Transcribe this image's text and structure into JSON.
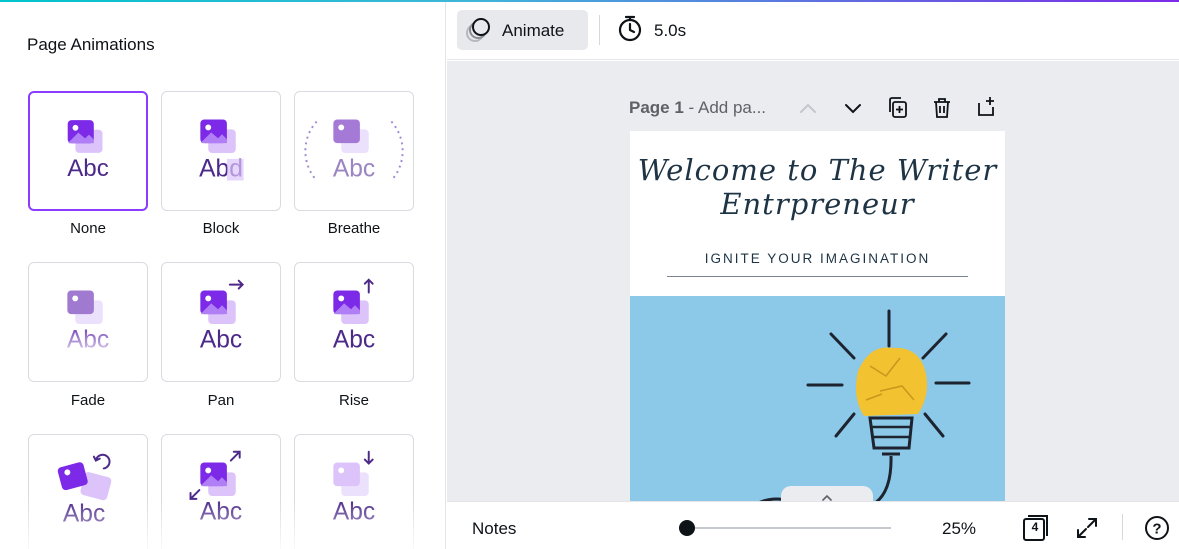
{
  "panel": {
    "title": "Page Animations",
    "animations": [
      {
        "label": "None",
        "selected": true
      },
      {
        "label": "Block",
        "selected": false
      },
      {
        "label": "Breathe",
        "selected": false
      },
      {
        "label": "Fade",
        "selected": false
      },
      {
        "label": "Pan",
        "selected": false
      },
      {
        "label": "Rise",
        "selected": false
      },
      {
        "label": "",
        "selected": false
      },
      {
        "label": "",
        "selected": false
      },
      {
        "label": "",
        "selected": false
      }
    ],
    "preview_text": "Abc",
    "preview_text_block": "Abd"
  },
  "toolbar": {
    "animate_label": "Animate",
    "duration": "5.0s"
  },
  "page": {
    "label_bold": "Page 1",
    "label_rest": " - Add pa...",
    "heading_line1": "Welcome to The Writer",
    "heading_line2": "Entrpreneur",
    "subheading": "IGNITE YOUR IMAGINATION"
  },
  "footer": {
    "notes_label": "Notes",
    "zoom": "25%",
    "zoom_fraction": 0.0,
    "page_count": "4",
    "help_label": "?"
  },
  "colors": {
    "accent": "#8b3dff",
    "icon_purple": "#7d2ae8",
    "text_purple": "#4d2a8a",
    "photo_blue": "#8cc8e8",
    "bulb_yellow": "#f2c230"
  }
}
